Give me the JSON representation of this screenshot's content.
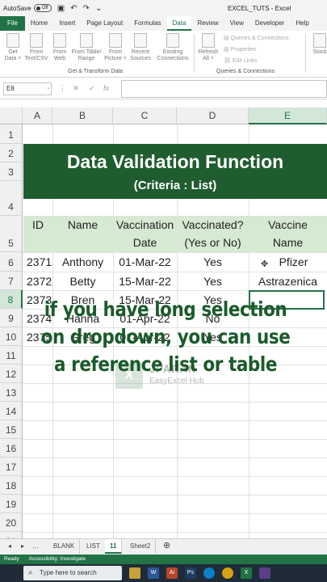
{
  "titlebar": {
    "autosave_label": "AutoSave",
    "autosave_state": "Off",
    "doc_title": "EXCEL_TUTS  -  Excel"
  },
  "ribbon_tabs": [
    "File",
    "Home",
    "Insert",
    "Page Layout",
    "Formulas",
    "Data",
    "Review",
    "View",
    "Developer",
    "Help"
  ],
  "ribbon": {
    "get_data": "Get Data ˅",
    "from_text": "From Text/CSV",
    "from_web": "From Web",
    "from_table": "From Table/ Range",
    "from_picture": "From Picture ˅",
    "recent_sources": "Recent Sources",
    "existing_connections": "Existing Connections",
    "group_get_transform": "Get & Transform Data",
    "refresh_all": "Refresh All ˅",
    "queries_connections": "Queries & Connections",
    "properties": "Properties",
    "edit_links": "Edit Links",
    "group_queries": "Queries & Connections",
    "stocks": "Stock"
  },
  "formula_bar": {
    "name_box": "E8",
    "formula": ""
  },
  "columns": [
    "A",
    "B",
    "C",
    "D",
    "E"
  ],
  "rows": [
    "1",
    "2",
    "3",
    "4",
    "5",
    "6",
    "7",
    "8",
    "9",
    "10",
    "11",
    "12",
    "13",
    "14",
    "15",
    "16",
    "17",
    "18",
    "19",
    "20",
    "21"
  ],
  "banner": {
    "title": "Data Validation Function",
    "subtitle": "(Criteria : List)"
  },
  "table": {
    "headers": [
      {
        "line1": "ID",
        "line2": ""
      },
      {
        "line1": "Name",
        "line2": ""
      },
      {
        "line1": "Vaccination",
        "line2": "Date"
      },
      {
        "line1": "Vaccinated?",
        "line2": "(Yes or No)"
      },
      {
        "line1": "Vaccine",
        "line2": "Name"
      }
    ],
    "rows": [
      [
        "2371",
        "Anthony",
        "01-Mar-22",
        "Yes",
        "Pfizer"
      ],
      [
        "2372",
        "Betty",
        "15-Mar-22",
        "Yes",
        "Astrazenica"
      ],
      [
        "2373",
        "Bren",
        "15-Mar-22",
        "Yes",
        ""
      ],
      [
        "2374",
        "Hanna",
        "01-Apr-22",
        "No",
        ""
      ],
      [
        "2375",
        "Greg",
        "01-Apr-22",
        "Yes",
        ""
      ]
    ]
  },
  "watermark": {
    "line1": "JPARAN",
    "line2": "EasyExcel Hub"
  },
  "overlay_text": "if you have long selection on dropdown, you can use a reference list or table",
  "sheet_tabs": [
    "BLANK",
    "LIST",
    "11",
    "Sheet2"
  ],
  "status": {
    "ready": "Ready",
    "accessibility": "Accessibility: Investigate"
  },
  "taskbar": {
    "search_placeholder": "Type here to search"
  },
  "colors": {
    "excel_green": "#217346",
    "banner_bg": "#1f5c2e",
    "header_band": "#d6e9d2"
  }
}
